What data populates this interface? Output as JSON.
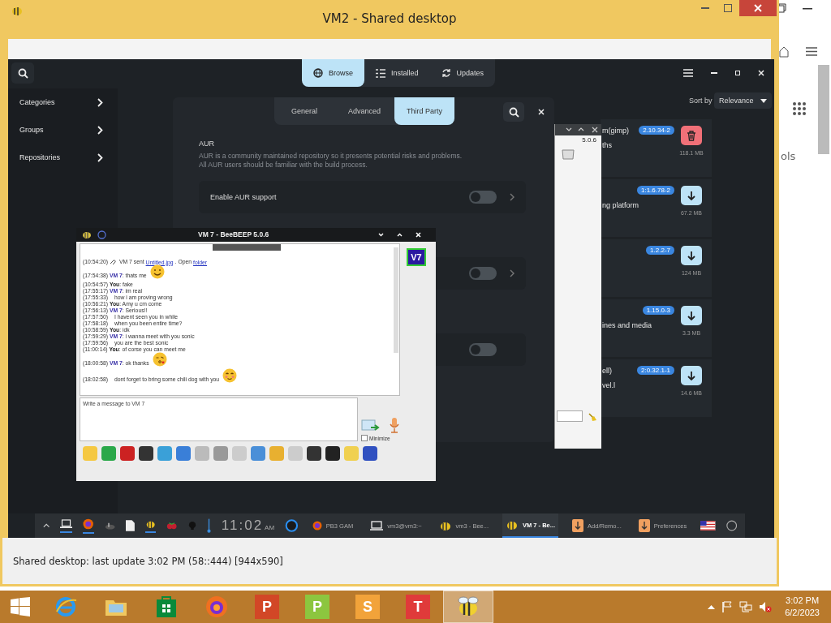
{
  "window": {
    "title": "VM2 - Shared desktop"
  },
  "browser_edge": {
    "text": "ols"
  },
  "remote": {
    "tabs": [
      {
        "label": "Browse",
        "kind": "globe",
        "selected": true
      },
      {
        "label": "Installed",
        "kind": "list",
        "selected": false
      },
      {
        "label": "Updates",
        "kind": "refresh",
        "selected": false
      }
    ],
    "sidebar": {
      "items": [
        {
          "label": "Categories"
        },
        {
          "label": "Groups"
        },
        {
          "label": "Repositories"
        }
      ]
    },
    "sort": {
      "label": "Sort by",
      "value": "Relevance"
    },
    "packages": [
      {
        "name": "m(gimp)",
        "description": "ths",
        "version": "2.10.34-2",
        "size": "118.1 MB",
        "installed": true
      },
      {
        "description": "ng platform",
        "version": "1:1.6.78-2",
        "size": "67.2 MB",
        "installed": false
      },
      {
        "version": "1.2.2-7",
        "size": "124 MB",
        "installed": false
      },
      {
        "description": "ines and media",
        "version": "1.15.0-3",
        "size": "3.3 MB",
        "installed": false
      },
      {
        "name": "ell)",
        "description": "vel.l",
        "version": "2:0.32.1-1",
        "size": "14.6 MB",
        "installed": false
      }
    ],
    "preferences": {
      "tabs": [
        {
          "label": "General",
          "selected": false
        },
        {
          "label": "Advanced",
          "selected": false
        },
        {
          "label": "Third Party",
          "selected": true
        }
      ],
      "section_title": "AUR",
      "section_lines": [
        "AUR is a community maintained repository so it presents potential risks and problems.",
        "All AUR users should be familiar with the build process."
      ],
      "rows": [
        {
          "label": "Enable AUR support",
          "on": false,
          "chevron": true
        },
        {
          "on": false,
          "chevron": true
        },
        {
          "on": false,
          "chevron": false
        }
      ]
    },
    "file_window": {
      "version": "5.0.6"
    },
    "chat": {
      "title": "VM 7 - BeeBEEP 5.0.6",
      "avatar": "V7",
      "file_message": {
        "time": "(10:54:20)",
        "author": "VM 7",
        "text": "sent",
        "file": "Untitled.jpg",
        "open": ". Open",
        "folder": "folder"
      },
      "messages": [
        {
          "time": "(17:54:38)",
          "author": "VM 7",
          "me": false,
          "text": ": thats me",
          "kind": "smile"
        },
        {
          "time": "(10:54:57)",
          "author": "You",
          "me": true,
          "text": ": fake"
        },
        {
          "time": "(17:55:17)",
          "author": "VM 7",
          "me": false,
          "text": ": im real"
        },
        {
          "time": "(17:55:33)",
          "text": "how i am proving wrong"
        },
        {
          "time": "(10:56:21)",
          "author": "You",
          "me": true,
          "text": ": Amy u cm come"
        },
        {
          "time": "(17:56:13)",
          "author": "VM 7",
          "me": false,
          "text": ": Serious!!"
        },
        {
          "time": "(17:57:50)",
          "text": "I havent seen you in while"
        },
        {
          "time": "(17:58:18)",
          "text": "when you been entire time?"
        },
        {
          "time": "(10:58:59)",
          "author": "You",
          "me": true,
          "text": ": idk"
        },
        {
          "time": "(17:59:29)",
          "author": "VM 7",
          "me": false,
          "text": ": i wanna meet with you sonic"
        },
        {
          "time": "(17:59:56)",
          "text": "you are the best sonic"
        },
        {
          "time": "(11:00:14)",
          "author": "You",
          "me": true,
          "text": ": of corse you can meet me"
        },
        {
          "time": "(18:00:58)",
          "author": "VM 7",
          "me": false,
          "text": ": ok thanks",
          "kind": "kiss"
        },
        {
          "time": "(18:02:58)",
          "text": "dont forget to bring some chili dog with you",
          "kind": "blush"
        }
      ],
      "input": {
        "placeholder": "Write a message to VM 7"
      },
      "minimize": {
        "label": "Minimize",
        "checked": false
      }
    },
    "taskbar": {
      "clock": {
        "time": "11:02",
        "ampm": "AM"
      },
      "tasks": [
        {
          "label": "PB3 GAM",
          "kind": "firefox",
          "selected": false
        },
        {
          "label": "vm3@vm3:~",
          "kind": "terminal",
          "selected": false
        },
        {
          "label": "vm3 - Bee...",
          "kind": "bee",
          "selected": false
        },
        {
          "label": "VM 7 - Be...",
          "kind": "bee",
          "selected": true
        },
        {
          "label": "Add/Remo...",
          "kind": "download",
          "selected": false
        },
        {
          "label": "Preferences",
          "kind": "download",
          "selected": false
        }
      ]
    }
  },
  "status_bar": "Shared desktop: last update 3:02 PM (58::444) [944x590]",
  "win_taskbar": {
    "apps": [
      {
        "kind": "ie",
        "selected": false
      },
      {
        "kind": "folder",
        "selected": false
      },
      {
        "kind": "store",
        "selected": false
      },
      {
        "kind": "firefox",
        "selected": false
      },
      {
        "kind": "powerpoint",
        "letter": "P",
        "selected": false
      },
      {
        "kind": "free",
        "letter": "P",
        "color": "#8cc63f",
        "selected": false
      },
      {
        "kind": "free",
        "letter": "S",
        "color": "#f2a33a",
        "selected": false
      },
      {
        "kind": "free",
        "letter": "T",
        "color": "#e03a3a",
        "selected": false
      },
      {
        "kind": "bee",
        "selected": true
      }
    ],
    "clock": {
      "time": "3:02 PM",
      "date": "6/2/2023"
    }
  }
}
